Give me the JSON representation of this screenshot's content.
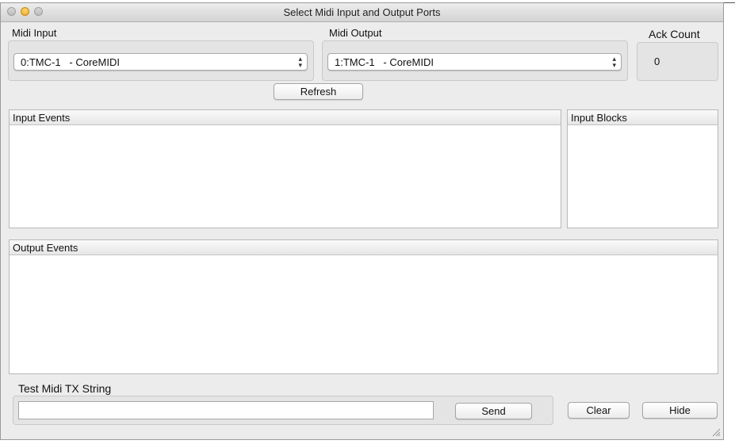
{
  "window": {
    "title": "Select Midi Input and Output Ports"
  },
  "midi_input": {
    "label": "Midi Input",
    "selected": "0:TMC-1   - CoreMIDI"
  },
  "midi_output": {
    "label": "Midi Output",
    "selected": "1:TMC-1   - CoreMIDI"
  },
  "ack": {
    "label": "Ack Count",
    "value": "0"
  },
  "buttons": {
    "refresh": "Refresh",
    "send": "Send",
    "clear": "Clear",
    "hide": "Hide"
  },
  "panels": {
    "input_events": "Input Events",
    "input_blocks": "Input Blocks",
    "output_events": "Output Events"
  },
  "test_tx": {
    "label": "Test Midi TX String",
    "value": ""
  },
  "icons": {
    "select_arrow": "⇕",
    "resize": "resize-grip-icon"
  }
}
